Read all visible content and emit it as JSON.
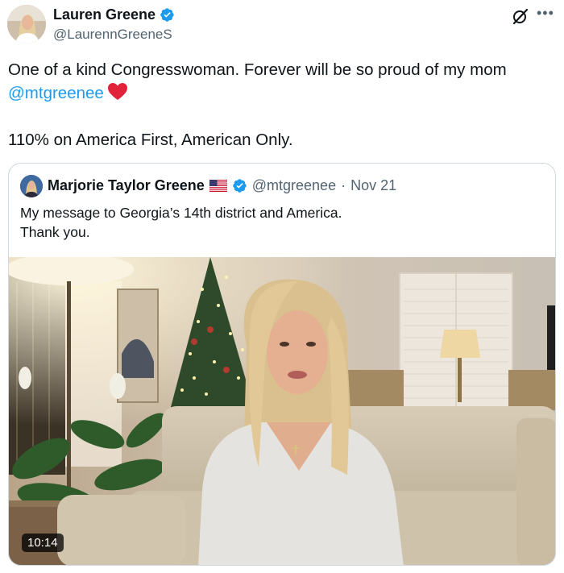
{
  "author": {
    "name": "Lauren Greene",
    "handle": "@LaurennGreeneS",
    "verified": true
  },
  "icons": {
    "grok": "grok-icon",
    "more": "more-icon",
    "verified": "verified-badge-icon",
    "heart": "red-heart-emoji",
    "flag": "us-flag-emoji"
  },
  "tweet": {
    "line1": "One of a kind Congresswoman. Forever will be so proud of my mom",
    "mention": "@mtgreenee",
    "line2": "110% on America First, American Only."
  },
  "quote": {
    "name": "Marjorie Taylor Greene",
    "handle": "@mtgreenee",
    "separator": "·",
    "date": "Nov 21",
    "line1": "My message to Georgia’s 14th district and America.",
    "line2": "Thank you.",
    "video_duration": "10:14"
  },
  "colors": {
    "link": "#1d9bf0",
    "verified": "#1d9bf0",
    "secondary_text": "#536471",
    "border": "#cfd9de"
  }
}
